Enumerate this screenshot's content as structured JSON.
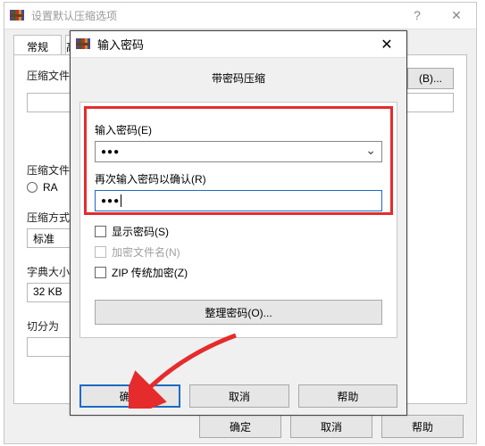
{
  "parent": {
    "title": "设置默认压缩选项",
    "tabs": {
      "active": "常规",
      "cut": "高"
    },
    "row1": {
      "label": "压缩文件",
      "btn": "(B)..."
    },
    "row2": {
      "label": "压缩文件",
      "radio_prefix": "RA"
    },
    "row3": {
      "label": "压缩方式",
      "value": "标准"
    },
    "row4": {
      "label": "字典大小",
      "value": "32 KB"
    },
    "row5": {
      "label": "切分为"
    },
    "footer": {
      "ok": "确定",
      "cancel": "取消",
      "help": "帮助"
    }
  },
  "modal": {
    "title": "输入密码",
    "header": "带密码压缩",
    "pw1_label": "输入密码(E)",
    "pw1_value": "●●●",
    "pw2_label": "再次输入密码以确认(R)",
    "pw2_value": "●●●",
    "check_show": "显示密码(S)",
    "check_encrypt": "加密文件名(N)",
    "check_zip": "ZIP 传统加密(Z)",
    "organize": "整理密码(O)...",
    "footer": {
      "ok": "确定",
      "cancel": "取消",
      "help": "帮助"
    }
  }
}
